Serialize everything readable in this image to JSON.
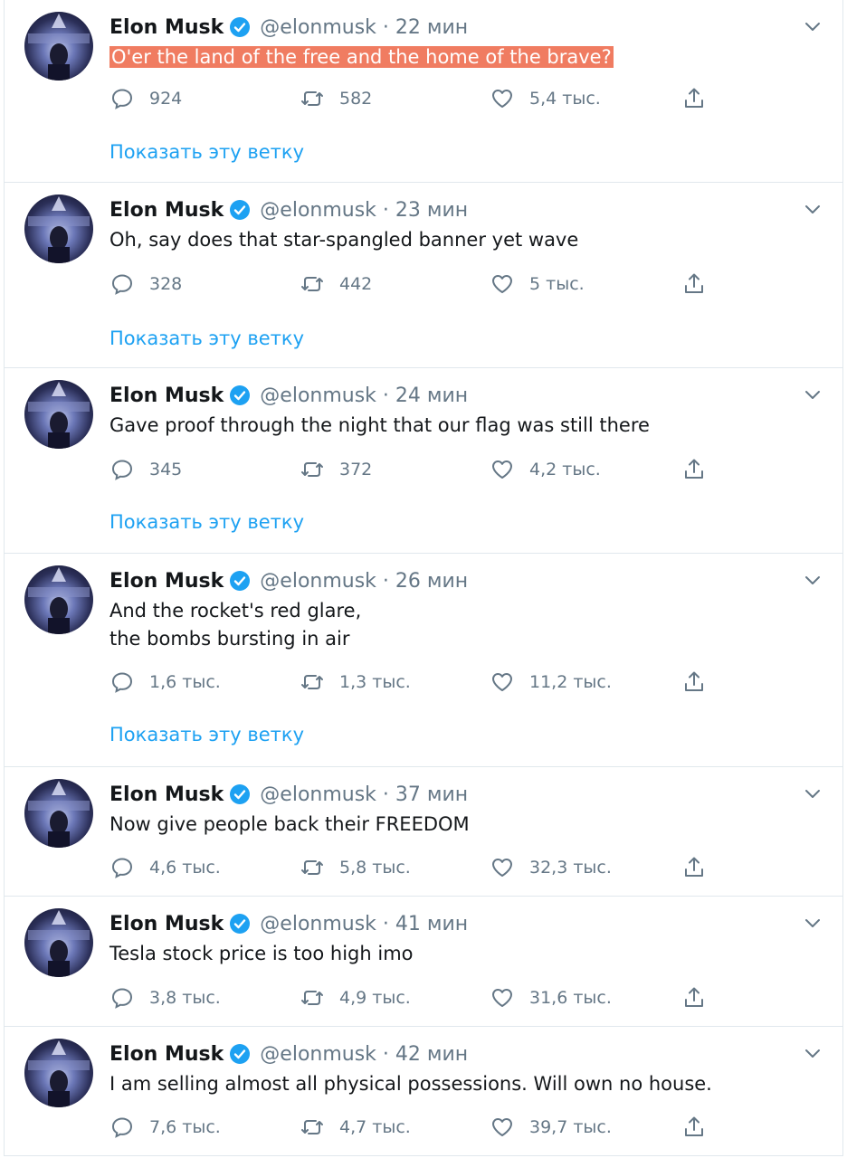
{
  "colors": {
    "link": "#1da1f2",
    "muted": "#657786",
    "highlight": "#f07c61",
    "verified": "#1da1f2"
  },
  "icons": {
    "reply": "reply-icon",
    "retweet": "retweet-icon",
    "like": "heart-icon",
    "share": "share-icon",
    "caret": "chevron-down-icon",
    "verified": "verified-badge-icon"
  },
  "tweets": [
    {
      "name": "Elon Musk",
      "meta": "@elonmusk · 22 мин",
      "text": "O'er the land of the free and the home of the brave?",
      "highlighted": true,
      "replies": "924",
      "retweets": "582",
      "likes": "5,4 тыс.",
      "thread": "Показать эту ветку"
    },
    {
      "name": "Elon Musk",
      "meta": "@elonmusk · 23 мин",
      "text": "Oh, say does that star-spangled banner yet wave",
      "replies": "328",
      "retweets": "442",
      "likes": "5 тыс.",
      "thread": "Показать эту ветку"
    },
    {
      "name": "Elon Musk",
      "meta": "@elonmusk · 24 мин",
      "text": "Gave proof through the night that our flag was still there",
      "replies": "345",
      "retweets": "372",
      "likes": "4,2 тыс.",
      "thread": "Показать эту ветку"
    },
    {
      "name": "Elon Musk",
      "meta": "@elonmusk · 26 мин",
      "text": "And the rocket's red glare,\nthe bombs bursting in air",
      "replies": "1,6 тыс.",
      "retweets": "1,3 тыс.",
      "likes": "11,2 тыс.",
      "thread": "Показать эту ветку"
    },
    {
      "name": "Elon Musk",
      "meta": "@elonmusk · 37 мин",
      "text": "Now give people back their FREEDOM",
      "replies": "4,6 тыс.",
      "retweets": "5,8 тыс.",
      "likes": "32,3 тыс."
    },
    {
      "name": "Elon Musk",
      "meta": "@elonmusk · 41 мин",
      "text": "Tesla stock price is too high imo",
      "replies": "3,8 тыс.",
      "retweets": "4,9 тыс.",
      "likes": "31,6 тыс."
    },
    {
      "name": "Elon Musk",
      "meta": "@elonmusk · 42 мин",
      "text": "I am selling almost all physical possessions. Will own no house.",
      "replies": "7,6 тыс.",
      "retweets": "4,7 тыс.",
      "likes": "39,7 тыс."
    }
  ]
}
